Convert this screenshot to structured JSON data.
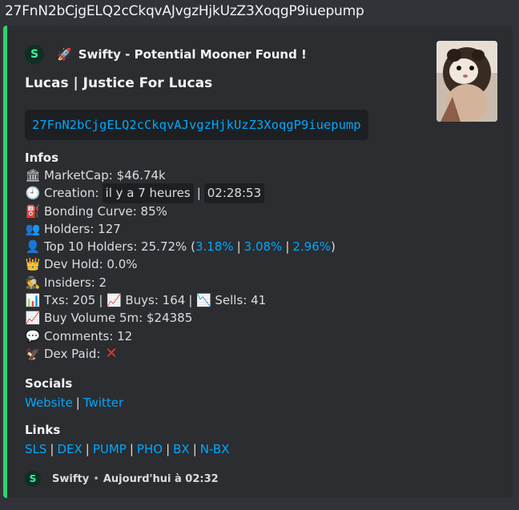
{
  "top_address": "27FnN2bCjgELQ2cCkqvAJvgzHjkUzZ3XoqgP9iuepump",
  "embed": {
    "accent_color": "#2dd36f",
    "author": {
      "icon": "swifty-logo-icon",
      "rocket_icon": "rocket-icon",
      "text": "Swifty - Potential Mooner Found !"
    },
    "title": "Lucas | Justice For Lucas",
    "contract": "27FnN2bCjgELQ2cCkqvAJvgzHjkUzZ3XoqgP9iuepump",
    "thumbnail_icon": "ferret-image",
    "infos": {
      "heading": "Infos",
      "market_cap": "MarketCap: $46.74k",
      "creation_label": "Creation:",
      "creation_relative": "il y a 7 heures",
      "creation_time": "02:28:53",
      "bonding": "Bonding Curve: 85%",
      "holders": "Holders: 127",
      "top10_label": "Top 10 Holders: 25.72% (",
      "top10_h1": "3.18%",
      "top10_h2": "3.08%",
      "top10_h3": "2.96%",
      "top10_close": ")",
      "dev_hold": "Dev Hold: 0.0%",
      "insiders": "Insiders: 2",
      "txs": "Txs: 205",
      "buys": "Buys: 164",
      "sells": "Sells: 41",
      "buy_volume": "Buy Volume 5m: $24385",
      "comments": "Comments: 12",
      "dex_paid": "Dex Paid:"
    },
    "socials": {
      "heading": "Socials",
      "website": "Website",
      "twitter": "Twitter"
    },
    "links": {
      "heading": "Links",
      "items": [
        "SLS",
        "DEX",
        "PUMP",
        "PHO",
        "BX",
        "N-BX"
      ]
    },
    "footer": {
      "name": "Swifty",
      "time": "Aujourd'hui à 02:32"
    }
  }
}
